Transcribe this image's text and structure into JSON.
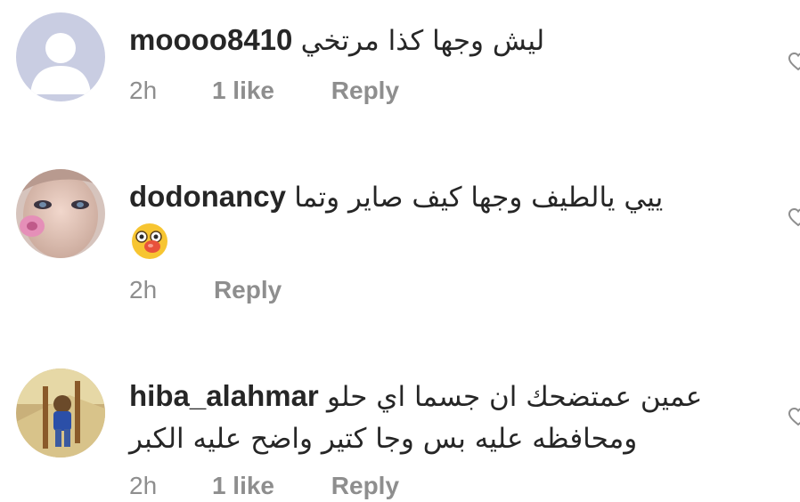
{
  "comments": [
    {
      "username": "moooo8410",
      "text": "ليش وجها كذا مرتخي",
      "time": "2h",
      "likes": "1 like",
      "reply": "Reply",
      "avatar_icon": "default-avatar-icon"
    },
    {
      "username": "dodonancy",
      "text": "ييي يالطيف وجها كيف صاير وتما",
      "emoji": "😵",
      "time": "2h",
      "likes": "",
      "reply": "Reply",
      "avatar_icon": "user-photo"
    },
    {
      "username": "hiba_alahmar",
      "text": "عمين عمتضحك ان جسما اي حلو ومحافظه عليه بس وجا كتير واضح عليه الكبر",
      "time": "2h",
      "likes": "1 like",
      "reply": "Reply",
      "avatar_icon": "user-photo"
    }
  ],
  "colors": {
    "primary_text": "#262626",
    "secondary_text": "#8e8e8e",
    "default_avatar_bg": "#c7cbe0"
  }
}
